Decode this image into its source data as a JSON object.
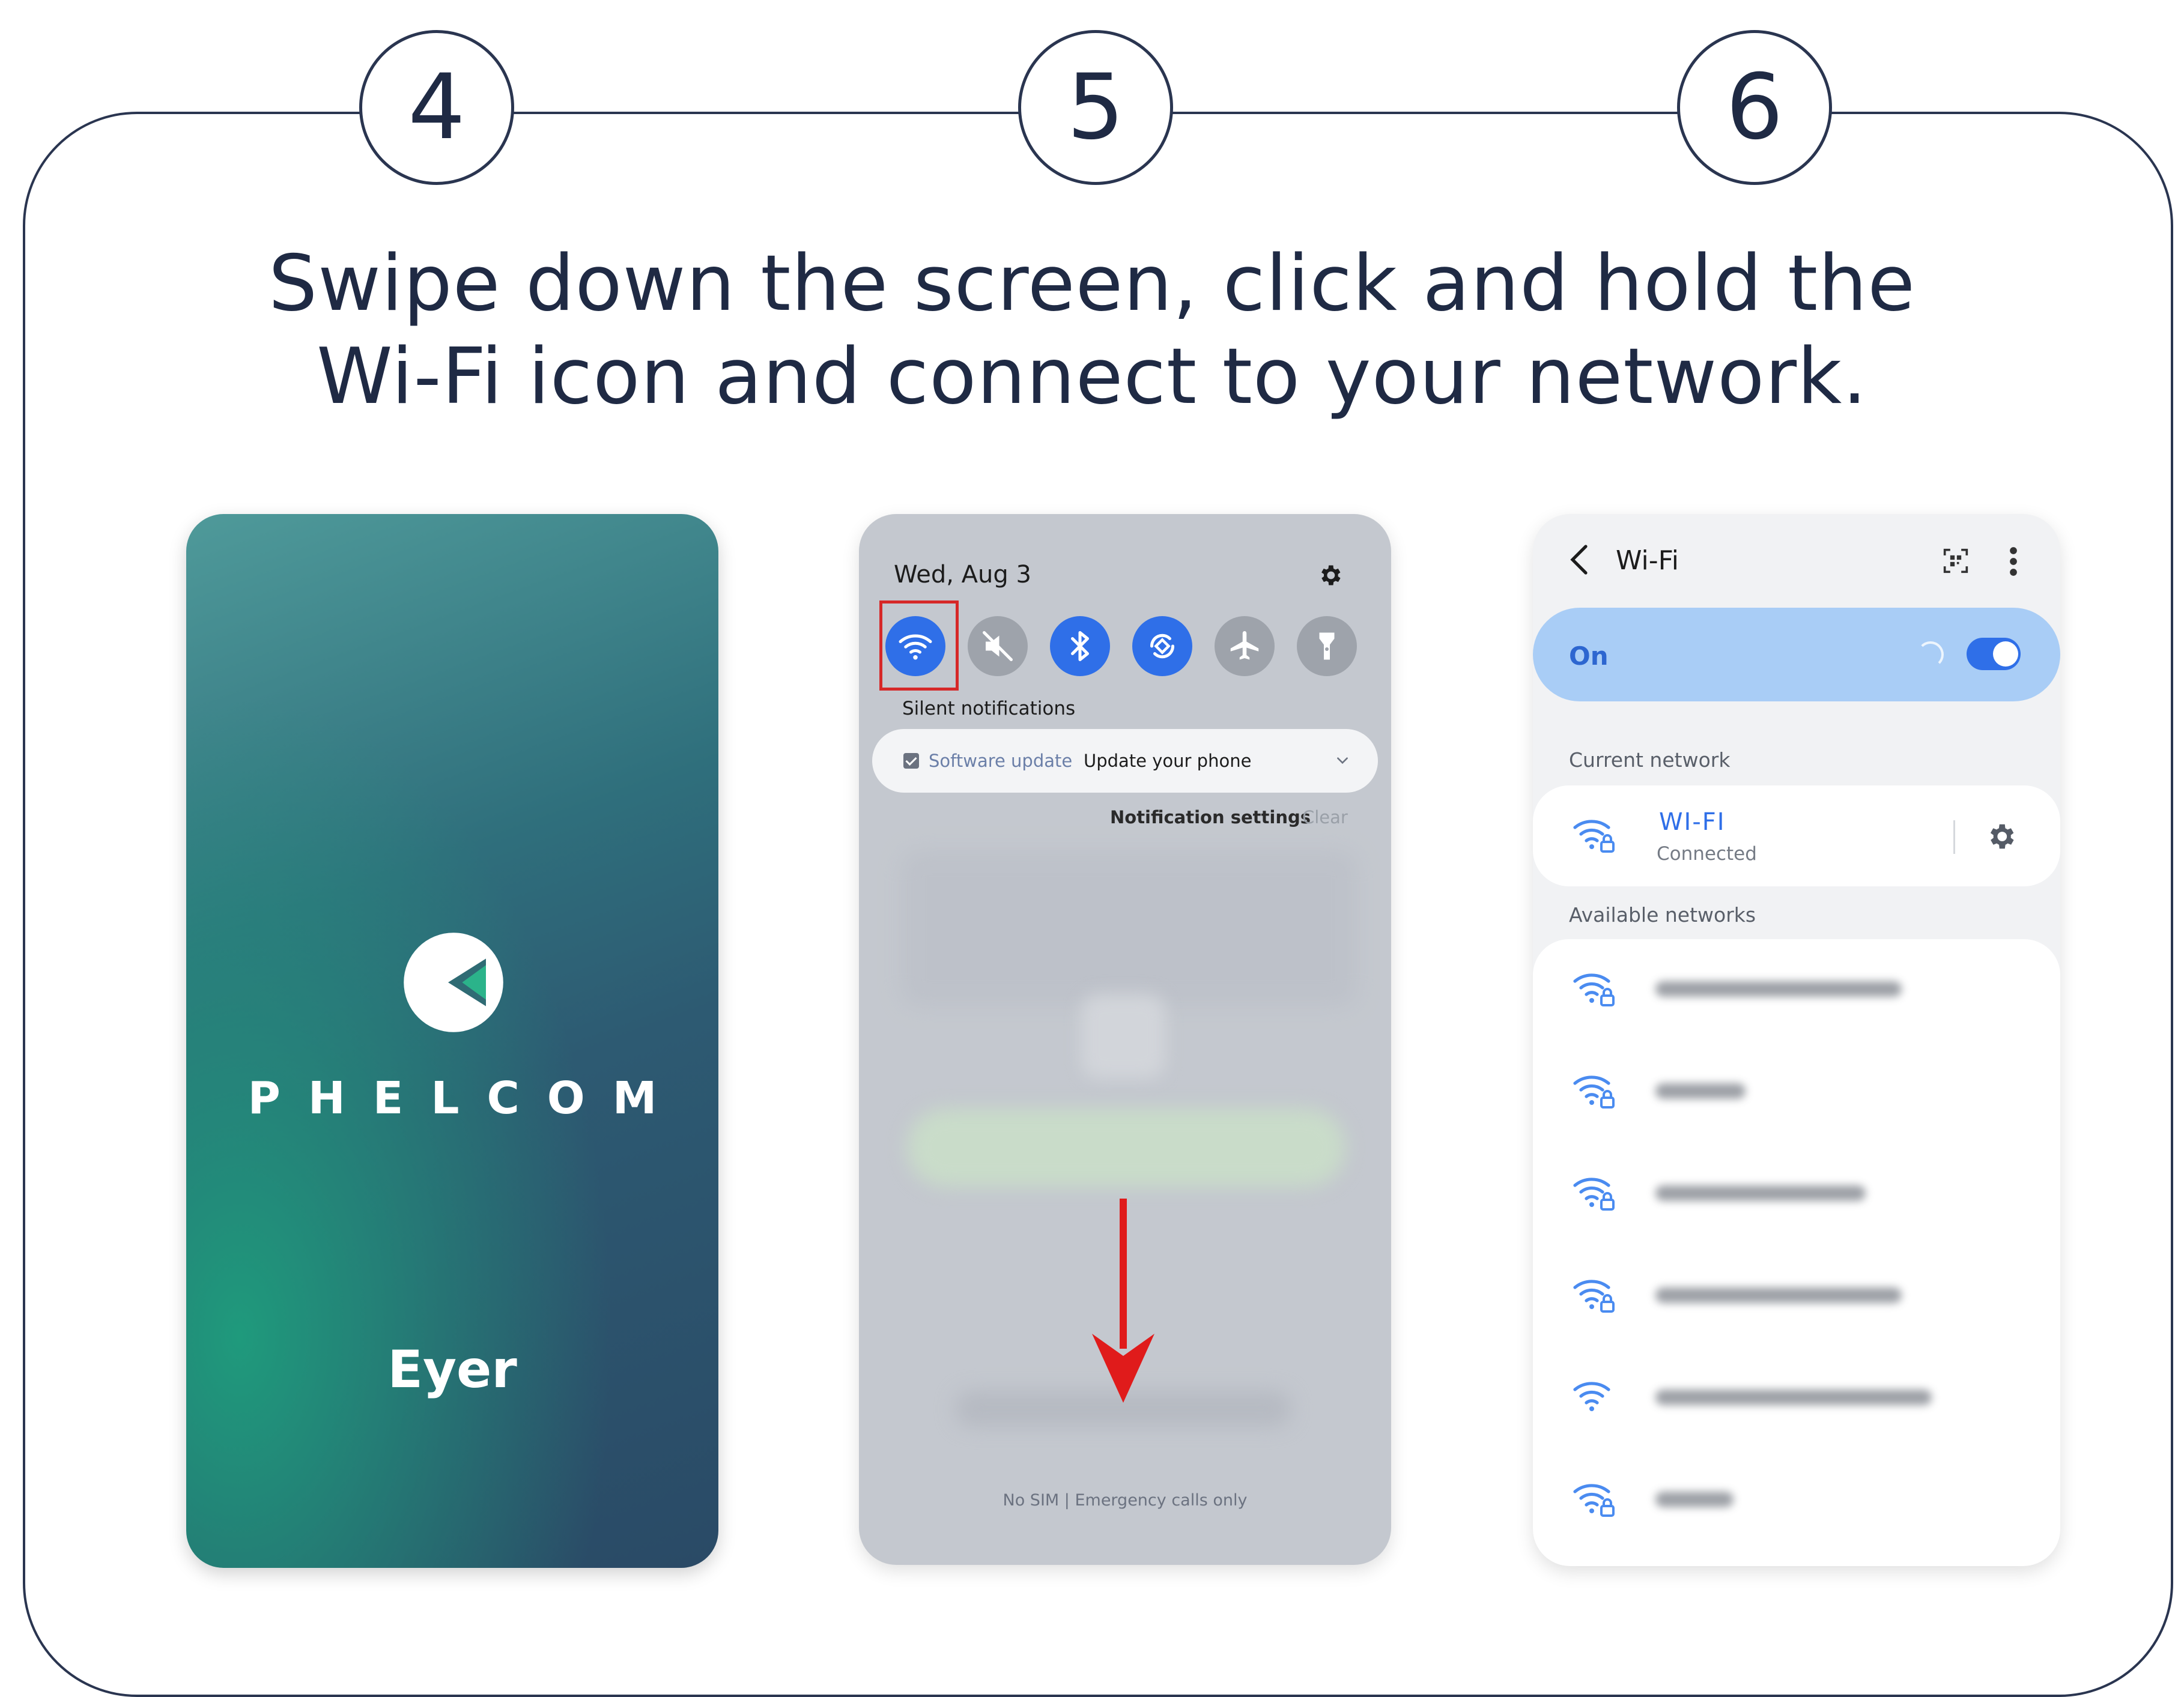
{
  "steps": [
    "4",
    "5",
    "6"
  ],
  "headline": {
    "line1": "Swipe down the screen, click and hold the",
    "line2": "Wi-Fi icon and connect to your network."
  },
  "phone1": {
    "brand": "PHELCOM",
    "app_name": "Eyer",
    "logo_icon": "phelcom-logo-icon"
  },
  "phone2": {
    "date": "Wed, Aug 3",
    "quick_settings": [
      {
        "name": "wifi-icon",
        "state": "on"
      },
      {
        "name": "mute-icon",
        "state": "off"
      },
      {
        "name": "bluetooth-icon",
        "state": "on"
      },
      {
        "name": "auto-rotate-icon",
        "state": "on"
      },
      {
        "name": "airplane-icon",
        "state": "off"
      },
      {
        "name": "flashlight-icon",
        "state": "off"
      }
    ],
    "silent_notifications": "Silent notifications",
    "notification": {
      "source": "Software update",
      "message": "Update your phone"
    },
    "notification_settings": "Notification settings",
    "clear": "Clear",
    "footer": "No SIM | Emergency calls only"
  },
  "phone3": {
    "title": "Wi-Fi",
    "toggle_label": "On",
    "toggle_on": true,
    "current_network_label": "Current network",
    "current_network": {
      "name": "WI-FI",
      "status": "Connected"
    },
    "available_networks_label": "Available networks"
  },
  "colors": {
    "accent": "#2f6fe8",
    "highlight": "#d62828",
    "text_dark": "#1f2a44"
  }
}
